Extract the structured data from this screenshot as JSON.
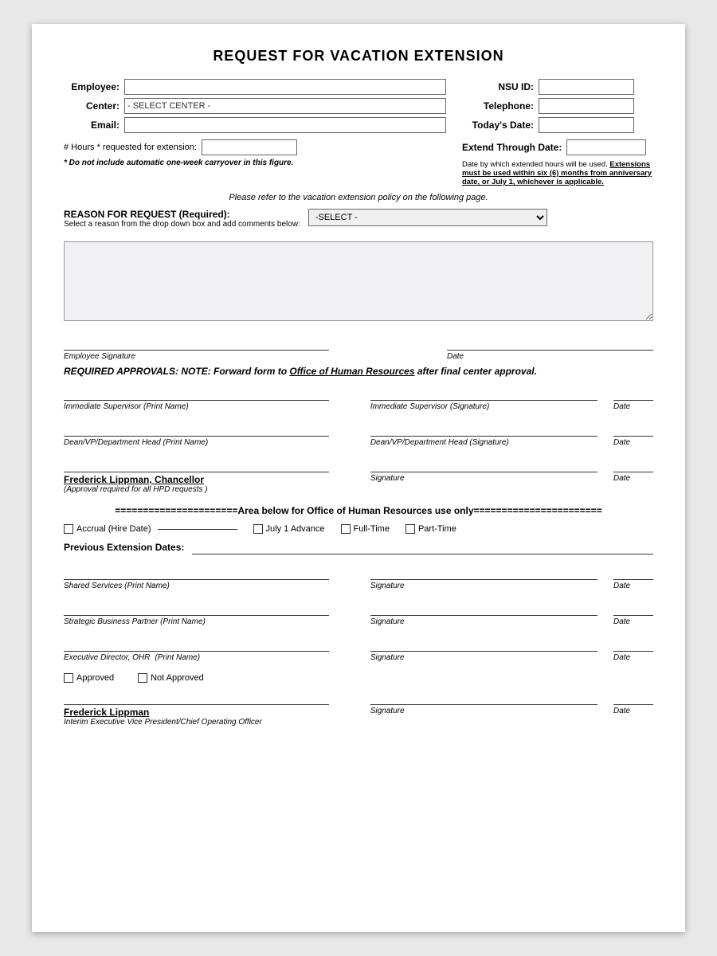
{
  "title": "REQUEST FOR VACATION EXTENSION",
  "form": {
    "employee_label": "Employee:",
    "nsu_id_label": "NSU ID:",
    "center_label": "Center:",
    "center_placeholder": "- SELECT CENTER -",
    "telephone_label": "Telephone:",
    "email_label": "Email:",
    "todays_date_label": "Today's Date:",
    "hours_label": "# Hours * requested for extension:",
    "extend_through_label": "Extend Through Date:",
    "asterisk_note": "* Do not include automatic one-week carryover in this figure.",
    "date_note": "Date by which extended hours will be used. Extensions must be used within six (6) months from anniversary date, or July 1, whichever is applicable.",
    "policy_note": "Please refer to the vacation extension policy on the following page.",
    "reason_title": "REASON FOR REQUEST (Required):",
    "reason_subtitle": "Select a reason from the drop down box and add comments below:",
    "reason_placeholder": "-SELECT -",
    "comments_placeholder": ""
  },
  "signatures": {
    "employee_sig_label": "Employee Signature",
    "date_label": "Date",
    "required_approvals": "REQUIRED APPROVALS:",
    "required_note": "NOTE:  Forward form to",
    "ohr_link": "Office of Human Resources",
    "required_after": "after final center approval.",
    "imm_supervisor_print": "Immediate Supervisor (Print Name)",
    "imm_supervisor_sig": "Immediate Supervisor (Signature)",
    "dean_print": "Dean/VP/Department Head (Print Name)",
    "dean_sig": "Dean/VP/Department Head (Signature)",
    "chancellor_name": "Frederick Lippman, Chancellor",
    "chancellor_note": "(Approval required for all HPD requests )",
    "signature_label": "Signature",
    "date_sig_label": "Date"
  },
  "ohr_section": {
    "divider": "======================Area below for Office of Human Resources use only=======================",
    "accrual_label": "Accrual (Hire Date)",
    "july_advance": "July 1 Advance",
    "full_time": "Full-Time",
    "part_time": "Part-Time",
    "prev_ext_label": "Previous Extension Dates:",
    "shared_services_print": "Shared Services (Print Name)",
    "shared_services_sig": "Signature",
    "shared_services_date": "Date",
    "strategic_print": "Strategic Business Partner (Print Name)",
    "strategic_sig": "Signature",
    "strategic_date": "Date",
    "exec_director_label": "Executive Director, OHR",
    "exec_print_label": "(Print Name)",
    "exec_sig": "Signature",
    "exec_date": "Date",
    "approved_label": "Approved",
    "not_approved_label": "Not Approved",
    "frederick_name": "Frederick Lippman",
    "interim_label": "Interim Executive Vice President/Chief Operating Officer",
    "final_sig": "Signature",
    "final_date": "Date"
  }
}
